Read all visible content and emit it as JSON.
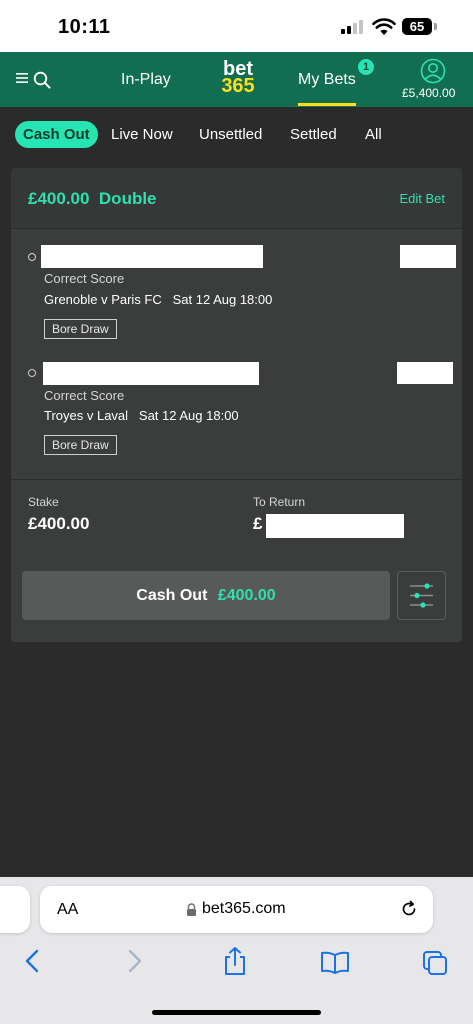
{
  "status_bar": {
    "time": "10:11",
    "battery": "65"
  },
  "header": {
    "nav_inplay": "In-Play",
    "logo_top": "bet",
    "logo_bottom": "365",
    "nav_mybets": "My Bets",
    "mybets_badge": "1",
    "balance": "£5,400.00"
  },
  "filters": [
    "Cash Out",
    "Live Now",
    "Unsettled",
    "Settled",
    "All"
  ],
  "bet": {
    "amount": "£400.00",
    "type": "Double",
    "edit_label": "Edit Bet",
    "selections": [
      {
        "market": "Correct Score",
        "event": "Grenoble v Paris FC",
        "datetime": "Sat 12 Aug 18:00",
        "result": "Bore Draw"
      },
      {
        "market": "Correct Score",
        "event": "Troyes v Laval",
        "datetime": "Sat 12 Aug 18:00",
        "result": "Bore Draw"
      }
    ],
    "stake_label": "Stake",
    "stake_value": "£400.00",
    "return_label": "To Return",
    "return_currency": "£",
    "cashout_label": "Cash Out",
    "cashout_amount": "£400.00"
  },
  "browser": {
    "aa": "AA",
    "url": "bet365.com"
  },
  "colors": {
    "header_green": "#126e51",
    "accent_teal": "#27e4b3",
    "logo_yellow": "#ffdf1b",
    "background": "#2b2b2b"
  },
  "icons": [
    "menu-icon",
    "search-icon",
    "account-icon",
    "settings-sliders-icon",
    "lock-icon",
    "reload-icon",
    "back-icon",
    "forward-icon",
    "share-icon",
    "bookmarks-icon",
    "tabs-icon"
  ]
}
